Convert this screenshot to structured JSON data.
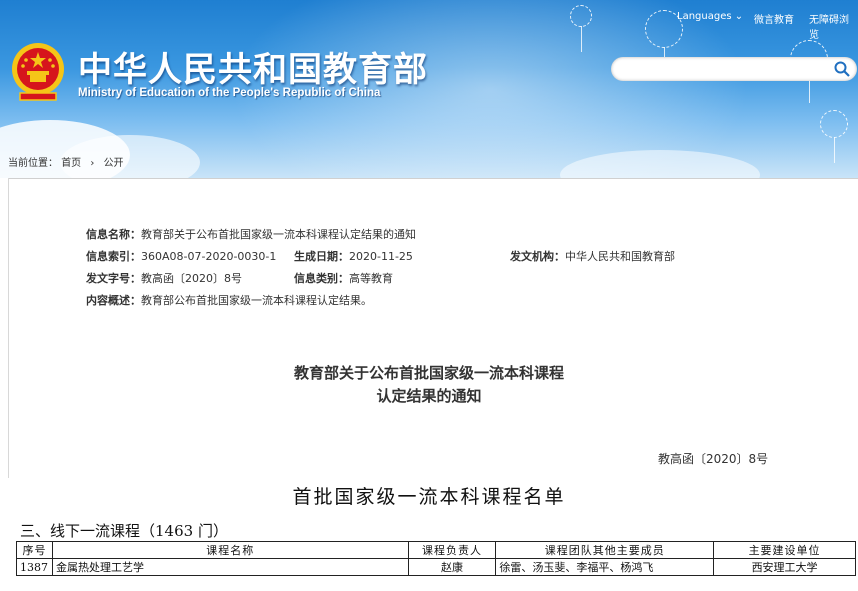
{
  "header": {
    "links": [
      "Languages",
      "微言教育",
      "无障碍浏览"
    ],
    "title_cn": "中华人民共和国教育部",
    "title_en": "Ministry of Education of the People's Republic of China",
    "search_placeholder": ""
  },
  "breadcrumb": {
    "label": "当前位置：",
    "items": [
      "首页",
      "公开"
    ],
    "separator": "›"
  },
  "meta": {
    "name_label": "信息名称：",
    "name_value": "教育部关于公布首批国家级一流本科课程认定结果的通知",
    "index_label": "信息索引：",
    "index_value": "360A08-07-2020-0030-1",
    "date_label": "生成日期：",
    "date_value": "2020-11-25",
    "org_label": "发文机构：",
    "org_value": "中华人民共和国教育部",
    "docno_label": "发文字号：",
    "docno_value": "教高函〔2020〕8号",
    "category_label": "信息类别：",
    "category_value": "高等教育",
    "summary_label": "内容概述：",
    "summary_value": "教育部公布首批国家级一流本科课程认定结果。"
  },
  "doc": {
    "title_line1": "教育部关于公布首批国家级一流本科课程",
    "title_line2": "认定结果的通知",
    "number": "教高函〔2020〕8号"
  },
  "list": {
    "title": "首批国家级一流本科课程名单",
    "section": "三、线下一流课程（1463 门）",
    "headers": [
      "序号",
      "课程名称",
      "课程负责人",
      "课程团队其他主要成员",
      "主要建设单位"
    ],
    "rows": [
      [
        "1387",
        "金属热处理工艺学",
        "赵康",
        "徐雷、汤玉斐、李福平、杨鸿飞",
        "西安理工大学"
      ]
    ]
  },
  "colors": {
    "banner_top": "#1f7fd1",
    "banner_bottom": "#c9e4f8",
    "emblem_red": "#d6151c",
    "emblem_gold": "#f5c518"
  }
}
